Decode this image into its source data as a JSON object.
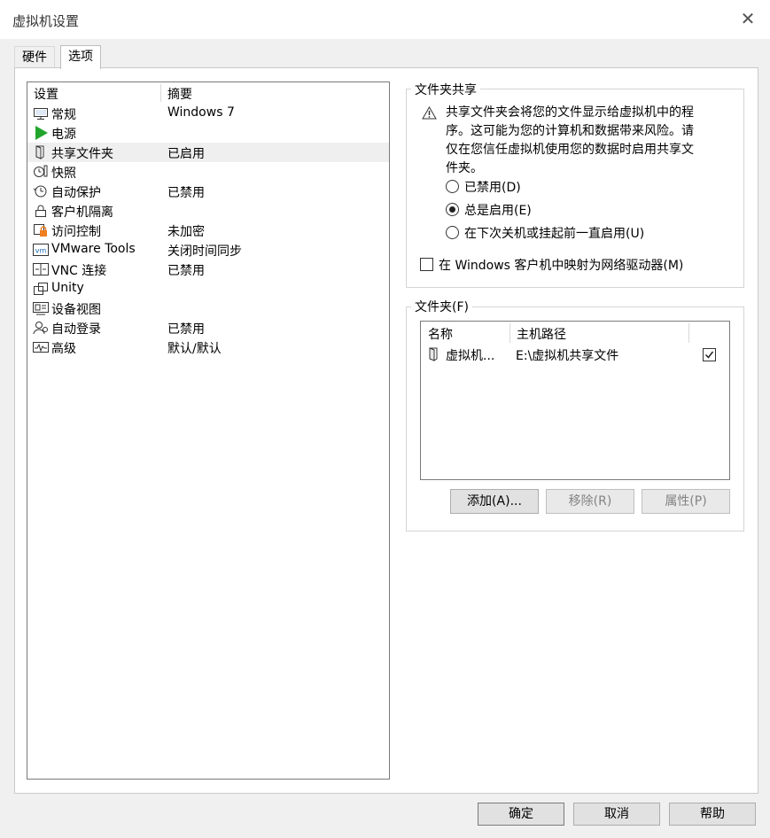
{
  "window": {
    "title": "虚拟机设置",
    "close_glyph": "✕"
  },
  "tabs": [
    {
      "label": "硬件",
      "active": false
    },
    {
      "label": "选项",
      "active": true
    }
  ],
  "settings": {
    "headers": {
      "setting": "设置",
      "summary": "摘要"
    },
    "items": [
      {
        "name": "常规",
        "summary": "Windows 7",
        "icon": "monitor-icon"
      },
      {
        "name": "电源",
        "summary": "",
        "icon": "power-play-icon"
      },
      {
        "name": "共享文件夹",
        "summary": "已启用",
        "icon": "shared-folder-icon",
        "selected": true
      },
      {
        "name": "快照",
        "summary": "",
        "icon": "snapshot-icon"
      },
      {
        "name": "自动保护",
        "summary": "已禁用",
        "icon": "clock-icon"
      },
      {
        "name": "客户机隔离",
        "summary": "",
        "icon": "lock-icon"
      },
      {
        "name": "访问控制",
        "summary": "未加密",
        "icon": "access-control-icon"
      },
      {
        "name": "VMware Tools",
        "summary": "关闭时间同步",
        "icon": "vm-icon"
      },
      {
        "name": "VNC 连接",
        "summary": "已禁用",
        "icon": "vnc-icon"
      },
      {
        "name": "Unity",
        "summary": "",
        "icon": "unity-icon"
      },
      {
        "name": "设备视图",
        "summary": "",
        "icon": "device-view-icon"
      },
      {
        "name": "自动登录",
        "summary": "已禁用",
        "icon": "auto-login-icon"
      },
      {
        "name": "高级",
        "summary": "默认/默认",
        "icon": "advanced-icon"
      }
    ]
  },
  "folder_sharing": {
    "title": "文件夹共享",
    "warning": "共享文件夹会将您的文件显示给虚拟机中的程序。这可能为您的计算机和数据带来风险。请仅在您信任虚拟机使用您的数据时启用共享文件夹。",
    "options": [
      {
        "label": "已禁用(D)",
        "checked": false
      },
      {
        "label": "总是启用(E)",
        "checked": true
      },
      {
        "label": "在下次关机或挂起前一直启用(U)",
        "checked": false
      }
    ],
    "map_drive_label": "在 Windows 客户机中映射为网络驱动器(M)",
    "map_drive_checked": false
  },
  "folders": {
    "title": "文件夹(F)",
    "headers": {
      "name": "名称",
      "host_path": "主机路径"
    },
    "rows": [
      {
        "name": "虚拟机...",
        "path": "E:\\虚拟机共享文件",
        "enabled": true
      }
    ],
    "buttons": {
      "add": "添加(A)...",
      "remove": "移除(R)",
      "properties": "属性(P)"
    }
  },
  "footer": {
    "ok": "确定",
    "cancel": "取消",
    "help": "帮助"
  },
  "colors": {
    "play_green": "#22a52b",
    "warning_orange": "#f07d1e",
    "vm_blue": "#1b6bb3"
  }
}
